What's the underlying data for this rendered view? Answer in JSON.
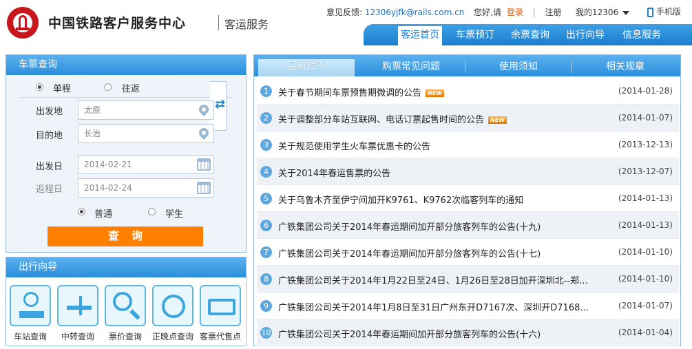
{
  "header": {
    "site_name": "中国铁路客户服务中心",
    "site_sub": "客运服务",
    "feedback_label": "意见反馈:",
    "feedback_email": "12306yjfk@rails.com.cn",
    "greeting": "您好,请",
    "login": "登录",
    "sep": "|",
    "register": "注册",
    "my12306": "我的12306",
    "mobile": "手机版"
  },
  "nav": [
    "客运首页",
    "车票预订",
    "余票查询",
    "出行向导",
    "信息服务"
  ],
  "ticket": {
    "title": "车票查询",
    "trip_oneway": "单程",
    "trip_round": "往返",
    "from_label": "出发地",
    "from_value": "太原",
    "to_label": "目的地",
    "to_value": "长治",
    "depart_label": "出发日",
    "depart_value": "2014-02-21",
    "return_label": "返程日",
    "return_value": "2014-02-24",
    "type_normal": "普通",
    "type_student": "学生",
    "search": "查询"
  },
  "guide": {
    "title": "出行向导",
    "items": [
      "车站查询",
      "中转查询",
      "票价查询",
      "正晚点查询",
      "客票代售点"
    ]
  },
  "news": {
    "tabs": [
      "最新动态",
      "购票常见问题",
      "使用须知",
      "相关规章"
    ],
    "badge": "NEW",
    "items": [
      {
        "n": "1",
        "title": "关于春节期间车票预售期微调的公告",
        "date": "(2014-01-28)"
      },
      {
        "n": "2",
        "title": "关于调整部分车站互联网、电话订票起售时间的公告",
        "date": "(2014-01-07)"
      },
      {
        "n": "3",
        "title": "关于规范使用学生火车票优惠卡的公告",
        "date": "(2013-12-13)"
      },
      {
        "n": "4",
        "title": "关于2014年春运售票的公告",
        "date": "(2013-12-07)"
      },
      {
        "n": "5",
        "title": "关于乌鲁木齐至伊宁间加开K9761、K9762次临客列车的通知",
        "date": "(2014-01-13)"
      },
      {
        "n": "6",
        "title": "广铁集团公司关于2014年春运期间加开部分旅客列车的公告(十九)",
        "date": "(2014-01-13)"
      },
      {
        "n": "7",
        "title": "广铁集团公司关于2014年春运期间加开部分旅客列车的公告(十七)",
        "date": "(2014-01-10)"
      },
      {
        "n": "8",
        "title": "广铁集团公司关于2014年1月22日至24日、1月26日至28日加开深圳北--郑...",
        "date": "(2014-01-10)"
      },
      {
        "n": "9",
        "title": "广铁集团公司关于2014年1月8日至31日广州东开D7167次、深圳开D7168...",
        "date": "(2014-01-07)"
      },
      {
        "n": "10",
        "title": "广铁集团公司关于2014年春运期间加开部分旅客列车的公告(十六)",
        "date": "(2014-01-04)"
      }
    ]
  },
  "colors": {
    "brand_red": "#c8161d",
    "nav_blue": "#2a8fdc",
    "search_orange": "#ff7f00",
    "email_blue": "#1c6fc0",
    "login_orange": "#e05a00"
  }
}
